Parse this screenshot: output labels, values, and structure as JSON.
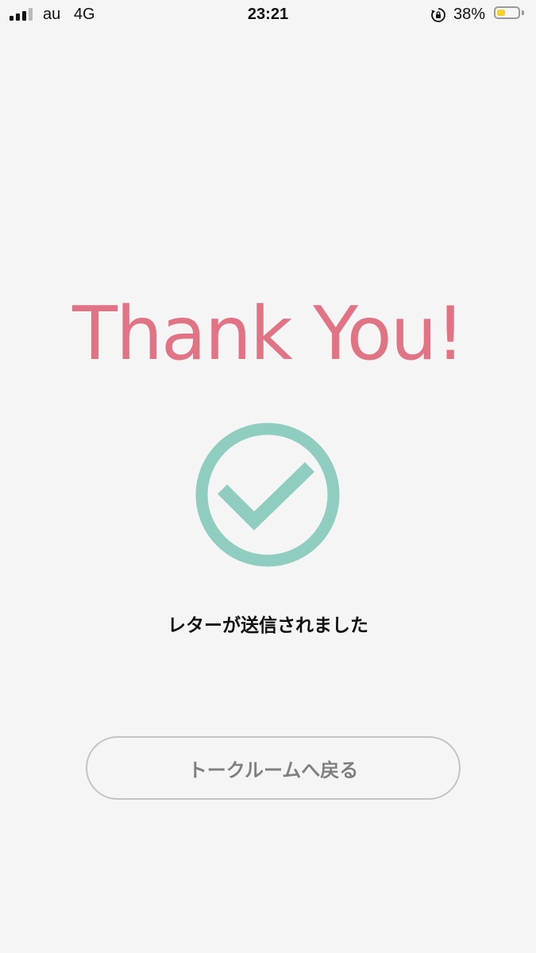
{
  "status_bar": {
    "carrier": "au",
    "network": "4G",
    "time": "23:21",
    "battery_percent": "38%",
    "battery_level": 0.38,
    "signal_bars_filled": 3,
    "signal_bars_total": 4
  },
  "main": {
    "heading": "Thank You!",
    "message": "レターが送信されました",
    "back_button_label": "トークルームへ戻る"
  },
  "colors": {
    "heading": "#e07484",
    "check": "#8fcdc1",
    "background": "#f5f5f5",
    "battery_fill": "#f5d033"
  }
}
